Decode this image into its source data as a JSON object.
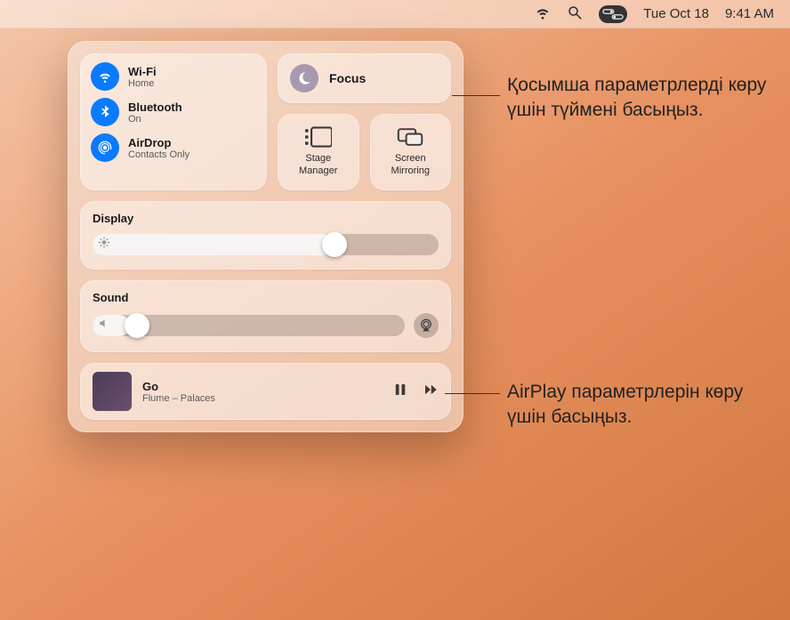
{
  "menubar": {
    "date": "Tue Oct 18",
    "time": "9:41 AM"
  },
  "connectivity": {
    "wifi": {
      "label": "Wi-Fi",
      "sub": "Home"
    },
    "bluetooth": {
      "label": "Bluetooth",
      "sub": "On"
    },
    "airdrop": {
      "label": "AirDrop",
      "sub": "Contacts Only"
    }
  },
  "focus": {
    "label": "Focus"
  },
  "stage": {
    "label": "Stage\nManager"
  },
  "mirror": {
    "label": "Screen\nMirroring"
  },
  "display": {
    "label": "Display",
    "value_pct": 70
  },
  "sound": {
    "label": "Sound",
    "value_pct": 12
  },
  "now_playing": {
    "title": "Go",
    "artist": "Flume – Palaces"
  },
  "callouts": {
    "focus": "Қосымша параметрлерді көру үшін түймені басыңыз.",
    "airplay": "AirPlay параметрлерін көру үшін басыңыз."
  }
}
